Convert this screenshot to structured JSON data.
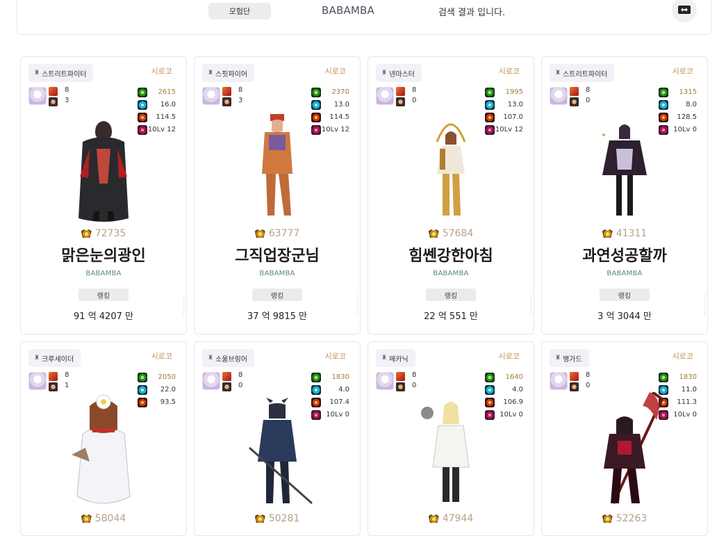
{
  "header": {
    "adventure_button": "모험단",
    "adventure_name": "BABAMBA",
    "result_text": "검색 결과 입니다."
  },
  "cards": [
    {
      "job": "스트리트파이터",
      "server": "시로코",
      "n1": "8",
      "n2": "3",
      "stats": [
        "2615",
        "16.0",
        "114.5",
        "10Lv 12"
      ],
      "score": "72735",
      "name": "맑은눈의광인",
      "adventure": "BABAMBA",
      "rank_label": "랭킹",
      "fame": "91 억 4207 만"
    },
    {
      "job": "스핏파이어",
      "server": "시로코",
      "n1": "8",
      "n2": "3",
      "stats": [
        "2370",
        "13.0",
        "114.5",
        "10Lv 12"
      ],
      "score": "63777",
      "name": "그직업장군님",
      "adventure": "BABAMBA",
      "rank_label": "랭킹",
      "fame": "37 억 9815 만"
    },
    {
      "job": "넨마스터",
      "server": "시로코",
      "n1": "8",
      "n2": "0",
      "stats": [
        "1995",
        "13.0",
        "107.0",
        "10Lv 12"
      ],
      "score": "57684",
      "name": "힘쎈강한아침",
      "adventure": "BABAMBA",
      "rank_label": "랭킹",
      "fame": "22 억 551 만"
    },
    {
      "job": "스트리트파이터",
      "server": "시로코",
      "n1": "8",
      "n2": "0",
      "stats": [
        "1315",
        "8.0",
        "128.5",
        "10Lv 0"
      ],
      "score": "41311",
      "name": "과연성공할까",
      "adventure": "BABAMBA",
      "rank_label": "랭킹",
      "fame": "3 억 3044 만"
    },
    {
      "job": "크루세이더",
      "server": "시로코",
      "n1": "8",
      "n2": "1",
      "stats": [
        "2050",
        "22.0",
        "93.5"
      ],
      "score": "58044"
    },
    {
      "job": "소울브링어",
      "server": "시로코",
      "n1": "8",
      "n2": "0",
      "stats": [
        "1830",
        "4.0",
        "107.4",
        "10Lv 0"
      ],
      "score": "50281"
    },
    {
      "job": "메카닉",
      "server": "시로코",
      "n1": "8",
      "n2": "0",
      "stats": [
        "1640",
        "4.0",
        "106.9",
        "10Lv 0"
      ],
      "score": "47944"
    },
    {
      "job": "뱅가드",
      "server": "시로코",
      "n1": "8",
      "n2": "0",
      "stats": [
        "1830",
        "11.0",
        "111.3",
        "10Lv 0"
      ],
      "score": "52263"
    }
  ],
  "icons": {
    "job_tag": "job-class-icon",
    "stat_icons": [
      "buff-power-icon",
      "crit-rate-icon",
      "element-cross-icon",
      "enchant-level-icon"
    ],
    "score": "crown-score-icon",
    "toggle": "swap-arrows-icon"
  },
  "colors": {
    "server": "#c2915a",
    "score": "#b8a08a",
    "adventure_label": "#5a8a7a",
    "buff_value": "#a37c3a"
  }
}
